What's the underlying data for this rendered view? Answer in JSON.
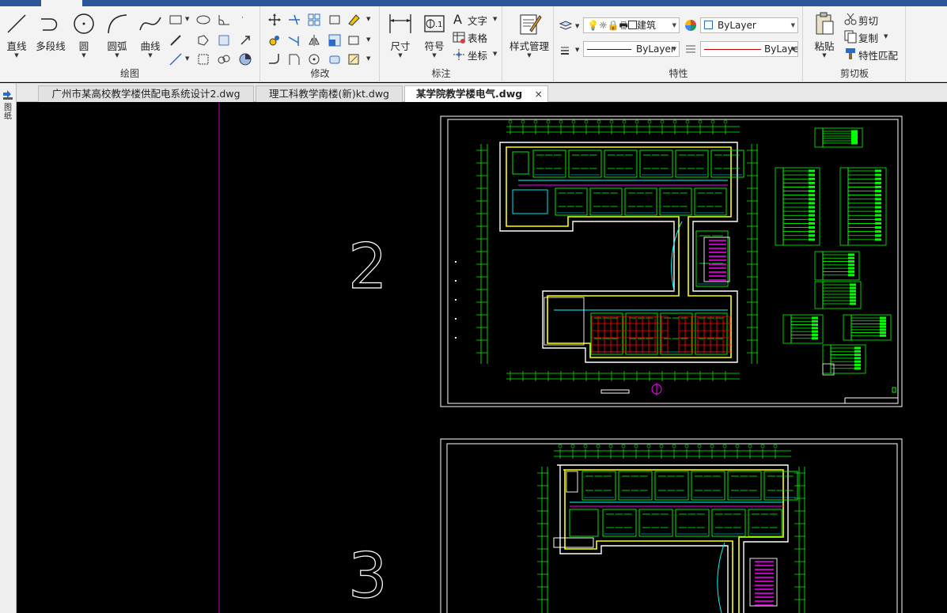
{
  "ribbon": {
    "draw": {
      "title": "绘图",
      "line": "直线",
      "polyline": "多段线",
      "circle": "圆",
      "arc": "圆弧",
      "curve": "曲线"
    },
    "modify": {
      "title": "修改"
    },
    "annotation": {
      "title": "标注",
      "dimension": "尺寸",
      "symbol": "符号",
      "text": "文字",
      "table": "表格",
      "coordinate": "坐标"
    },
    "style": {
      "label": "样式管理"
    },
    "properties": {
      "title": "特性",
      "layer_name": "建筑",
      "color": "ByLayer",
      "linetype": "ByLayer",
      "lineweight": "ByLaye"
    },
    "clipboard": {
      "title": "剪切板",
      "paste": "粘贴",
      "cut": "剪切",
      "copy": "复制",
      "match": "特性匹配"
    }
  },
  "tabs": [
    {
      "label": "广州市某高校教学楼供配电系统设计2.dwg"
    },
    {
      "label": "理工科教学南楼(新)kt.dwg"
    },
    {
      "label": "某学院教学楼电气.dwg",
      "active": true,
      "close": "×"
    }
  ],
  "sidebar": {
    "vertical_label": "图纸"
  },
  "canvas": {
    "sheet_numbers": [
      "2",
      "3"
    ],
    "colors": {
      "background": "#000000",
      "frame": "#ffffff",
      "wall": "#ffff00",
      "wiring": "#00ff00",
      "cyan": "#00ffff",
      "magenta": "#ff00ff",
      "red": "#ff0000",
      "ucs_line": "#c000c0"
    }
  }
}
